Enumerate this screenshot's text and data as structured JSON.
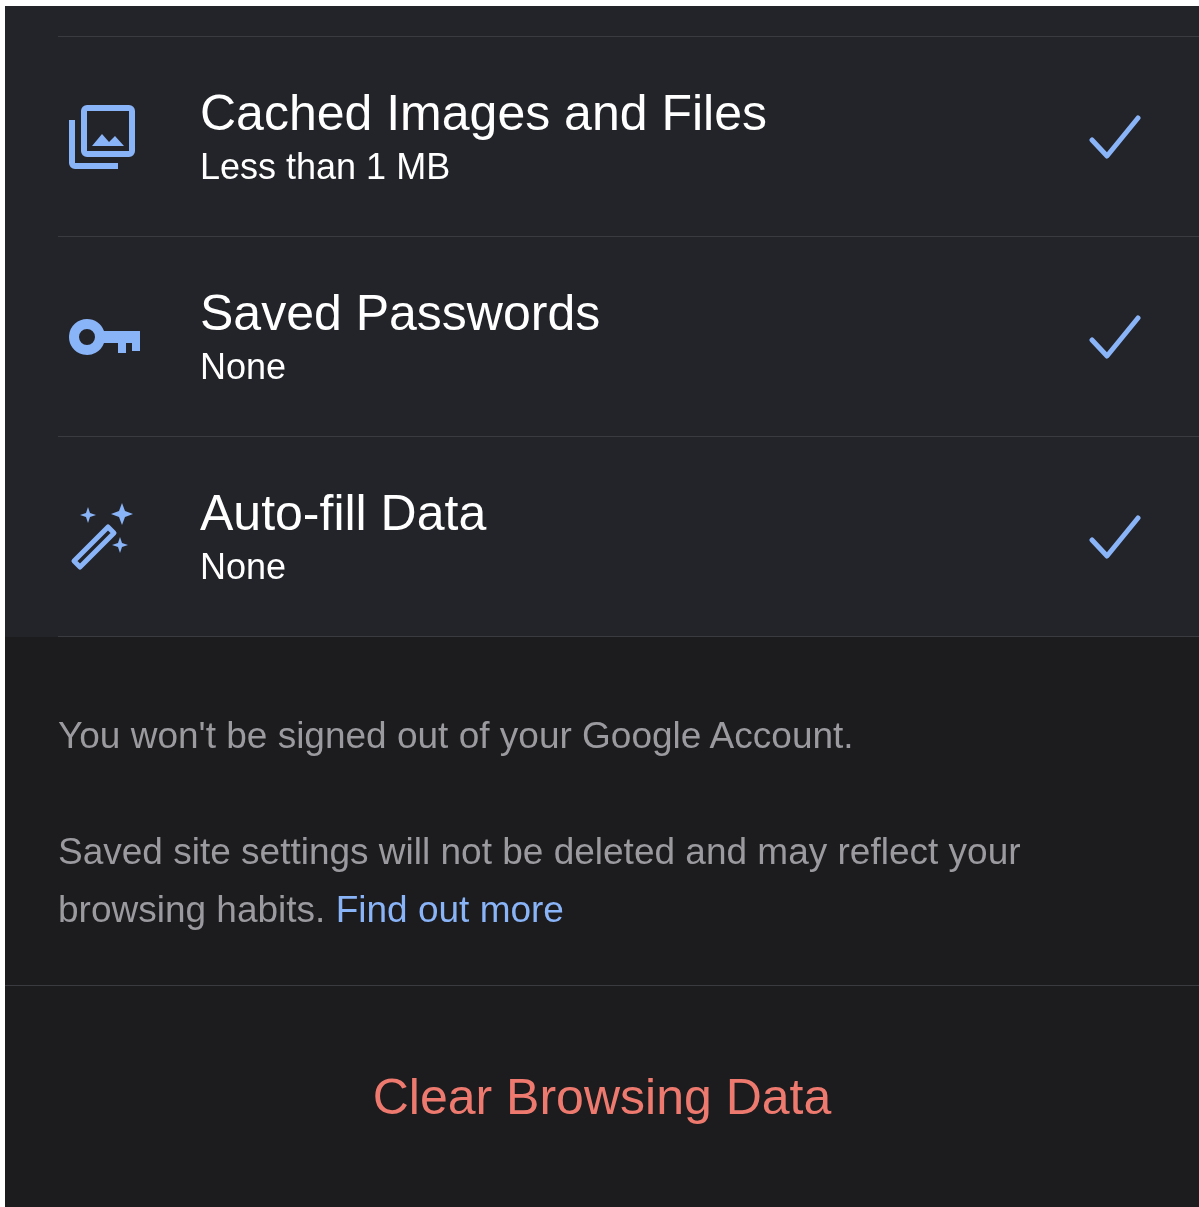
{
  "options": [
    {
      "title": "Cached Images and Files",
      "subtitle": "Less than 1 MB",
      "checked": true
    },
    {
      "title": "Saved Passwords",
      "subtitle": "None",
      "checked": true
    },
    {
      "title": "Auto-fill Data",
      "subtitle": "None",
      "checked": true
    }
  ],
  "notes": [
    {
      "text": "You won't be signed out of your Google Account."
    },
    {
      "text": "Saved site settings will not be deleted and may reflect your browsing habits.",
      "link": "Find out more"
    }
  ],
  "action": {
    "label": "Clear Browsing Data"
  }
}
